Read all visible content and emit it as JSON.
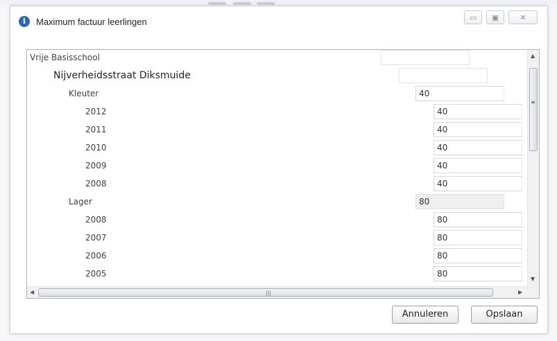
{
  "window": {
    "title": "Maximum factuur leerlingen",
    "icon": "info-icon",
    "controls": {
      "minimize": "▭",
      "restore": "▣",
      "close": "✕"
    }
  },
  "tree": [
    {
      "label": "Vrije Basisschool",
      "value": ""
    },
    {
      "label": "Nijverheidsstraat Diksmuide",
      "value": ""
    },
    {
      "label": "Kleuter",
      "value": "40"
    },
    {
      "label": "2012",
      "value": "40"
    },
    {
      "label": "2011",
      "value": "40"
    },
    {
      "label": "2010",
      "value": "40"
    },
    {
      "label": "2009",
      "value": "40"
    },
    {
      "label": "2008",
      "value": "40"
    },
    {
      "label": "Lager",
      "value": "80"
    },
    {
      "label": "2008",
      "value": "80"
    },
    {
      "label": "2007",
      "value": "80"
    },
    {
      "label": "2006",
      "value": "80"
    },
    {
      "label": "2005",
      "value": "80"
    }
  ],
  "scrollbars": {
    "grip": "|||",
    "vgrip": "≡",
    "up": "▲",
    "down": "▼",
    "left": "◀",
    "right": "▶"
  },
  "buttons": {
    "cancel": "Annuleren",
    "save": "Opslaan"
  }
}
